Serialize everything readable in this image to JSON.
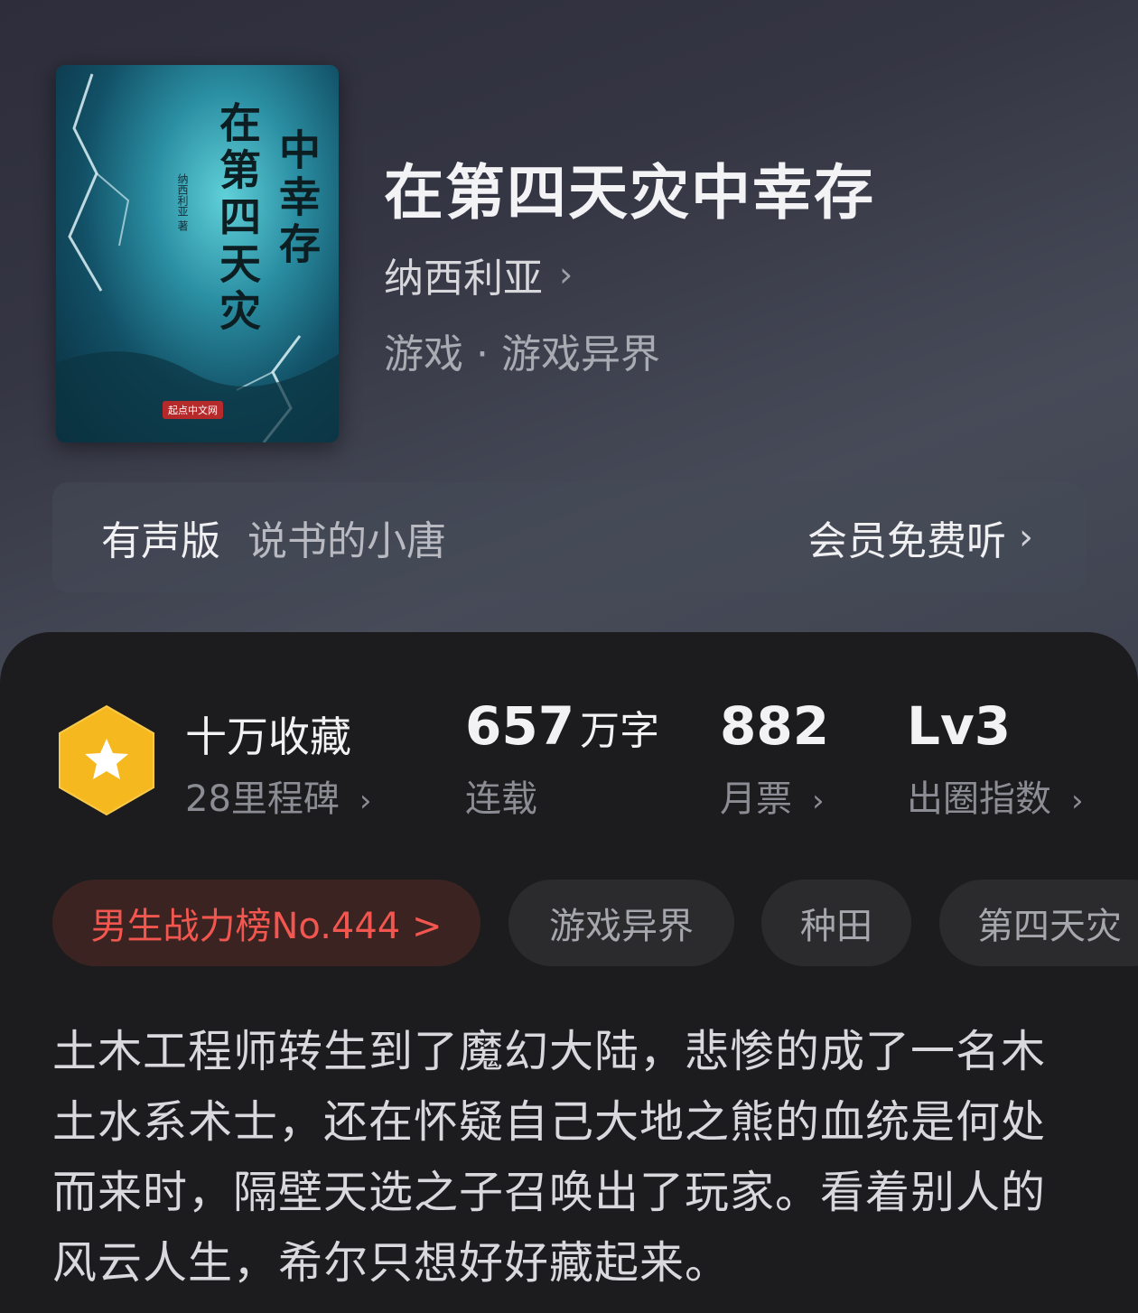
{
  "book": {
    "title": "在第四天灾中幸存",
    "author": "纳西利亚",
    "genre": "游戏 · 游戏异界",
    "cover": {
      "title_part1": "在第四天灾",
      "title_part2": "中幸存",
      "author_text": "纳西利亚 著",
      "publisher": "起点中文网"
    }
  },
  "audio": {
    "label": "有声版",
    "narrator": "说书的小唐",
    "action": "会员免费听"
  },
  "stats": {
    "collections": {
      "main": "十万收藏",
      "sub": "28里程碑"
    },
    "words": {
      "value": "657",
      "unit": "万字",
      "status": "连载"
    },
    "monthly_votes": {
      "value": "882",
      "label": "月票"
    },
    "breakout": {
      "value": "Lv3",
      "label": "出圈指数"
    }
  },
  "tags": {
    "rank": "男生战力榜No.444 >",
    "items": [
      "游戏异界",
      "种田",
      "第四天灾"
    ]
  },
  "description": "土木工程师转生到了魔幻大陆，悲惨的成了一名木土水系术士，还在怀疑自己大地之熊的血统是何处而来时，隔壁天选之子召唤出了玩家。看着别人的风云人生，希尔只想好好藏起来。",
  "colors": {
    "accent_red": "#f2564f",
    "badge_gold": "#f6b81f"
  },
  "icons": {
    "chevron": "chevron-right-icon",
    "badge": "star-hexagon-icon"
  }
}
